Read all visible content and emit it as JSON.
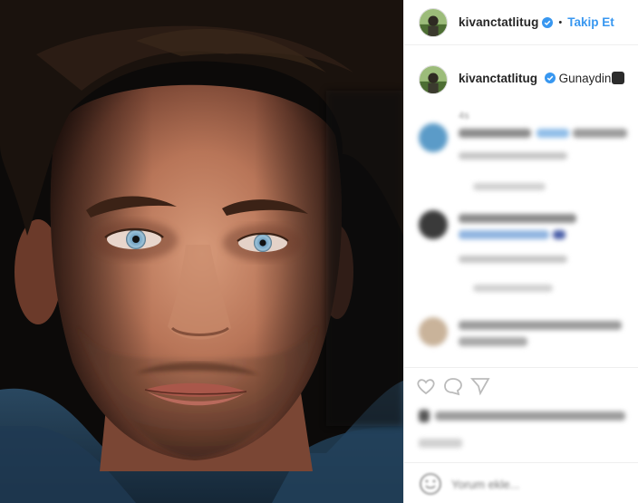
{
  "post": {
    "username": "kivanctatlitug",
    "separator": "•",
    "follow_label": "Takip Et"
  },
  "caption": {
    "username": "kivanctatlitug",
    "message": "Gunaydin",
    "time": "4s"
  },
  "add_comment": {
    "placeholder": "Yorum ekle..."
  },
  "colors": {
    "link_blue": "#3897f0",
    "verified_blue": "#3897f0",
    "text_primary": "#262626",
    "text_secondary": "#999999",
    "divider": "#efefef"
  },
  "icons": [
    "verified-badge-icon",
    "like-heart-icon",
    "comment-bubble-icon",
    "share-icon",
    "emoji-icon"
  ]
}
